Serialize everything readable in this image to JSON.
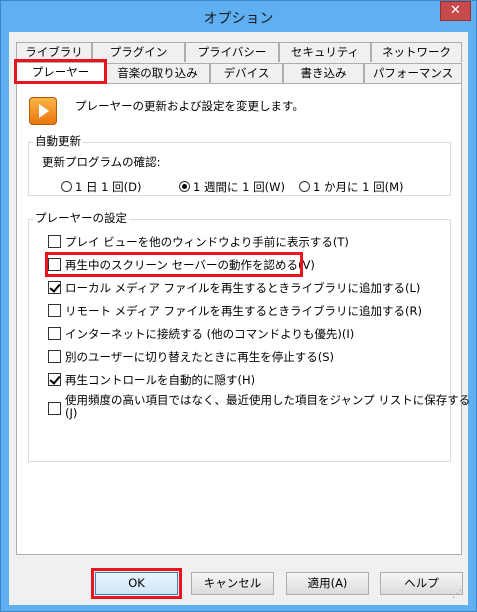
{
  "window": {
    "title": "オプション",
    "close_glyph": "✕"
  },
  "tabs_row1": [
    "ライブラリ",
    "プラグイン",
    "プライバシー",
    "セキュリティ",
    "ネットワーク"
  ],
  "tabs_row2": [
    "プレーヤー",
    "音楽の取り込み",
    "デバイス",
    "書き込み",
    "パフォーマンス"
  ],
  "active_tab": "プレーヤー",
  "panel": {
    "icon": "windows-media-player-icon",
    "description": "プレーヤーの更新および設定を変更します。",
    "auto_update": {
      "label": "自動更新",
      "check_label": "更新プログラムの確認:",
      "options": [
        "1 日 1 回(D)",
        "1 週間に 1 回(W)",
        "1 か月に 1 回(M)"
      ],
      "selected": 1
    },
    "player_settings": {
      "label": "プレーヤーの設定",
      "items": [
        {
          "label": "プレイ ビューを他のウィンドウより手前に表示する(T)",
          "checked": false
        },
        {
          "label": "再生中のスクリーン セーバーの動作を認める(V)",
          "checked": false
        },
        {
          "label": "ローカル メディア ファイルを再生するときライブラリに追加する(L)",
          "checked": true
        },
        {
          "label": "リモート メディア ファイルを再生するときライブラリに追加する(R)",
          "checked": false
        },
        {
          "label": "インターネットに接続する (他のコマンドよりも優先)(I)",
          "checked": false
        },
        {
          "label": "別のユーザーに切り替えたときに再生を停止する(S)",
          "checked": false
        },
        {
          "label": "再生コントロールを自動的に隠す(H)",
          "checked": true
        },
        {
          "label": "使用頻度の高い項目ではなく、最近使用した項目をジャンプ リストに保存する",
          "label2": "(J)",
          "checked": false
        }
      ]
    }
  },
  "buttons": {
    "ok": "OK",
    "cancel": "キャンセル",
    "apply": "適用(A)",
    "help": "ヘルプ"
  },
  "colors": {
    "titlebar": "#5fb0f3",
    "close": "#c74a4a",
    "highlight": "#e8141f"
  }
}
